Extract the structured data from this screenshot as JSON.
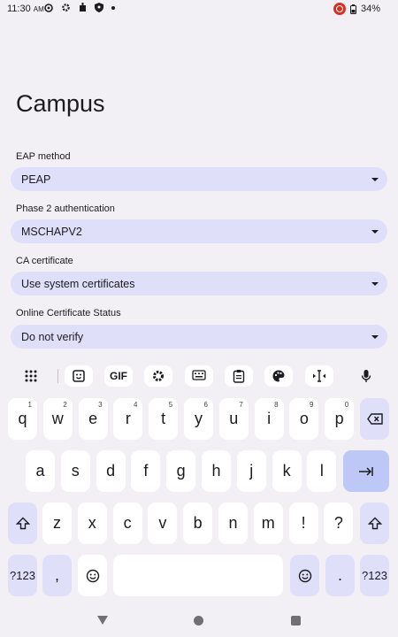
{
  "status_bar": {
    "time": "11:30",
    "ampm": "AM",
    "battery": "34%",
    "icons": [
      "settings-gear-icon",
      "settings-icon",
      "notification-icon",
      "shield-icon",
      "dot-icon"
    ]
  },
  "page": {
    "title": "Campus",
    "fields": [
      {
        "label": "EAP method",
        "value": "PEAP"
      },
      {
        "label": "Phase 2 authentication",
        "value": "MSCHAPV2"
      },
      {
        "label": "CA certificate",
        "value": "Use system certificates"
      },
      {
        "label": "Online Certificate Status",
        "value": "Do not verify"
      }
    ]
  },
  "keyboard": {
    "toolbar": {
      "gif_label": "GIF"
    },
    "row1": [
      {
        "k": "q",
        "n": "1"
      },
      {
        "k": "w",
        "n": "2"
      },
      {
        "k": "e",
        "n": "3"
      },
      {
        "k": "r",
        "n": "4"
      },
      {
        "k": "t",
        "n": "5"
      },
      {
        "k": "y",
        "n": "6"
      },
      {
        "k": "u",
        "n": "7"
      },
      {
        "k": "i",
        "n": "8"
      },
      {
        "k": "o",
        "n": "9"
      },
      {
        "k": "p",
        "n": "0"
      }
    ],
    "row2": [
      "a",
      "s",
      "d",
      "f",
      "g",
      "h",
      "j",
      "k",
      "l"
    ],
    "row3": [
      "z",
      "x",
      "c",
      "v",
      "b",
      "n",
      "m",
      "!",
      "?"
    ],
    "symbols_label": "?123",
    "comma": ",",
    "period": "."
  }
}
